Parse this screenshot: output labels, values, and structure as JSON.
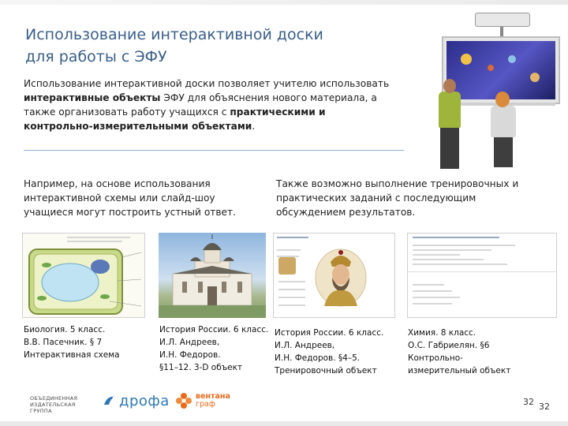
{
  "title": {
    "line1": "Использование интерактивной доски",
    "line2": "для работы с ЭФУ"
  },
  "intro": {
    "part1": "Использование интерактивной доски позволяет учителю использовать ",
    "bold1": "интерактивные объекты",
    "part2": " ЭФУ для объяснения нового материала, а также организовать работу учащихся с ",
    "bold2": "практическими и контрольно-измерительными объектами",
    "part3": "."
  },
  "left_paragraph": "Например, на основе использования интерактивной схемы или слайд-шоу учащиеся могут построить устный ответ.",
  "right_paragraph": "Также возможно выполнение тренировочных и практических заданий с последующим обсуждением результатов.",
  "captions": [
    {
      "l1": "Биология. 5 класс.",
      "l2": "В.В. Пасечник. § 7",
      "l3": "Интерактивная схема",
      "l4": ""
    },
    {
      "l1": "История России. 6 класс.",
      "l2": "И.Л. Андреев,",
      "l3": "И.Н. Федоров.",
      "l4": "§11–12. 3-D объект"
    },
    {
      "l1": "История России. 6 класс.",
      "l2": "И.Л. Андреев,",
      "l3": "И.Н. Федоров. §4–5.",
      "l4": "Тренировочный объект"
    },
    {
      "l1": "Химия. 8 класс.",
      "l2": "О.С. Габриелян. §6",
      "l3": "Контрольно-",
      "l4": "измерительный объект"
    }
  ],
  "footer": {
    "publisher_line1": "ОБЪЕДИНЕННАЯ",
    "publisher_line2": "ИЗДАТЕЛЬСКАЯ ГРУППА",
    "drofa": "дрофа",
    "ventana_line1": "вентана",
    "ventana_line2": "граф",
    "page_number_1": "32",
    "page_number_2": "32"
  },
  "colors": {
    "title": "#3a5f8a",
    "divider": "#8fb0cf",
    "drofa": "#2f78b8",
    "ventana": "#e86a1c"
  }
}
